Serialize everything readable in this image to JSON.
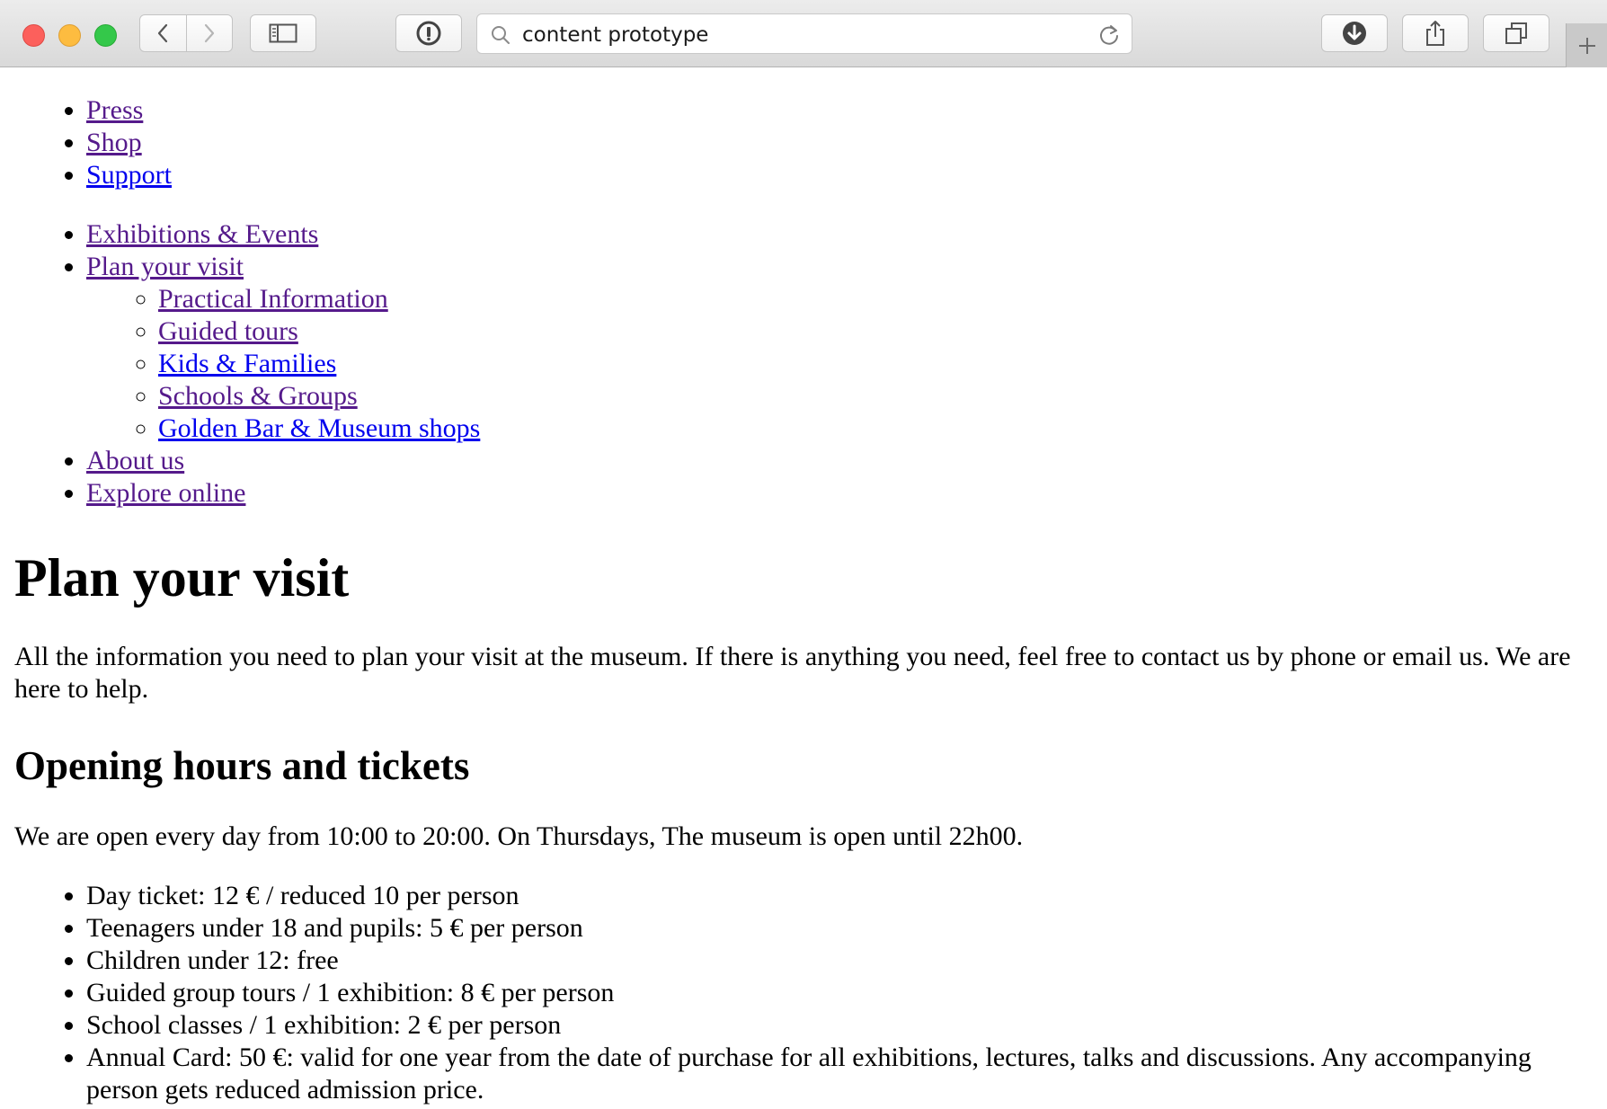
{
  "browser": {
    "url_text": "content prototype",
    "icons": {
      "back": "chevron-left-icon",
      "forward": "chevron-right-icon",
      "sidebar": "sidebar-icon",
      "password": "password-key-icon",
      "search": "search-icon",
      "reload": "reload-icon",
      "downloads": "download-icon",
      "share": "share-icon",
      "tabs": "tab-overview-icon",
      "new_tab": "plus-icon"
    }
  },
  "nav": {
    "top_links": [
      "Press",
      "Shop",
      "Support"
    ],
    "main": {
      "exhibitions": "Exhibitions & Events",
      "plan": "Plan your visit",
      "plan_sub": [
        "Practical Information",
        "Guided tours",
        "Kids & Families",
        "Schools & Groups",
        "Golden Bar & Museum shops"
      ],
      "about": "About us",
      "explore": "Explore online"
    }
  },
  "page": {
    "title": "Plan your visit",
    "intro": "All the information you need to plan your visit at the museum. If there is anything you need, feel free to contact us by phone or email us. We are here to help.",
    "section_title": "Opening hours and tickets",
    "hours_text": "We are open every day from 10:00 to 20:00. On Thursdays, The museum is open until 22h00.",
    "tickets": [
      "Day ticket: 12 € / reduced 10 per person",
      "Teenagers under 18 and pupils: 5 € per person",
      "Children under 12: free",
      "Guided group tours / 1 exhibition: 8 € per person",
      "School classes / 1 exhibition: 2 € per person",
      "Annual Card: 50 €: valid for one year from the date of purchase for all exhibitions, lectures, talks and discussions. Any accompanying person gets reduced admission price."
    ]
  },
  "colors": {
    "link": "#0000ee",
    "visited_link": "#551a8b",
    "close_button": "#fc605c",
    "minimize_button": "#fdbc40",
    "zoom_button": "#34c84a"
  }
}
